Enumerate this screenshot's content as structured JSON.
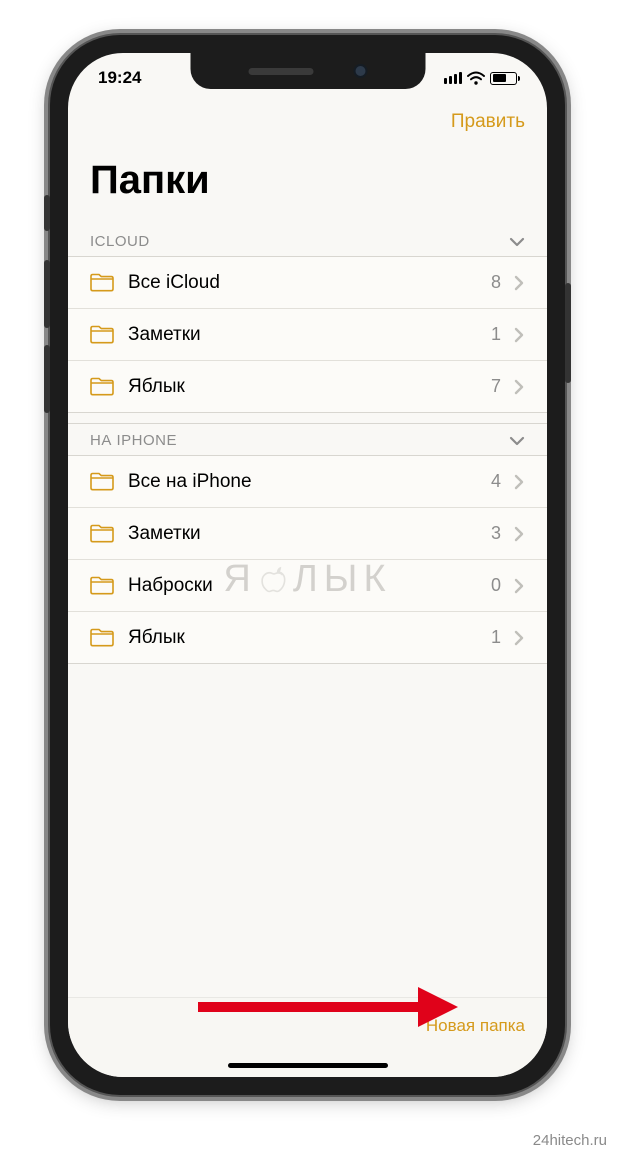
{
  "status": {
    "time": "19:24"
  },
  "nav": {
    "edit": "Править"
  },
  "title": "Папки",
  "sections": [
    {
      "header": "ICLOUD",
      "folders": [
        {
          "name": "Все iCloud",
          "count": "8"
        },
        {
          "name": "Заметки",
          "count": "1"
        },
        {
          "name": "Яблык",
          "count": "7"
        }
      ]
    },
    {
      "header": "НА IPHONE",
      "folders": [
        {
          "name": "Все на iPhone",
          "count": "4"
        },
        {
          "name": "Заметки",
          "count": "3"
        },
        {
          "name": "Наброски",
          "count": "0"
        },
        {
          "name": "Яблык",
          "count": "1"
        }
      ]
    }
  ],
  "toolbar": {
    "new_folder": "Новая папка"
  },
  "watermark": "ЯБЛЫК",
  "credit": "24hitech.ru",
  "colors": {
    "accent": "#d59a1b",
    "annotation": "#e0021a"
  }
}
